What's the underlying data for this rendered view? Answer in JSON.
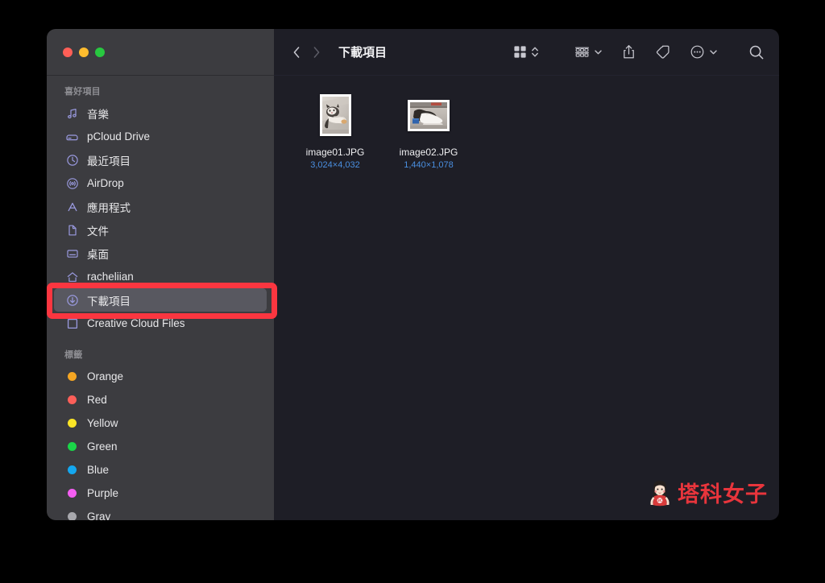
{
  "window": {
    "traffic_lights": {
      "close": "close",
      "minimize": "minimize",
      "maximize": "maximize"
    }
  },
  "toolbar": {
    "back_label": "‹",
    "forward_label": "›",
    "folder_title": "下載項目",
    "icon_view_label": "icon-view",
    "view_switch_label": "view-options",
    "group_label": "group-by",
    "share_label": "share",
    "tag_label": "tags",
    "more_label": "more-actions",
    "search_label": "search"
  },
  "sidebar": {
    "favorites_header": "喜好項目",
    "favorites": [
      {
        "label": "音樂",
        "icon": "music-note-icon",
        "selected": false
      },
      {
        "label": "pCloud Drive",
        "icon": "external-drive-icon",
        "selected": false
      },
      {
        "label": "最近項目",
        "icon": "clock-icon",
        "selected": false
      },
      {
        "label": "AirDrop",
        "icon": "airdrop-icon",
        "selected": false
      },
      {
        "label": "應用程式",
        "icon": "applications-icon",
        "selected": false
      },
      {
        "label": "文件",
        "icon": "document-icon",
        "selected": false
      },
      {
        "label": "桌面",
        "icon": "desktop-icon",
        "selected": false
      },
      {
        "label": "racheliian",
        "icon": "home-icon",
        "selected": false
      },
      {
        "label": "下載項目",
        "icon": "downloads-icon",
        "selected": true
      },
      {
        "label": "Creative Cloud Files",
        "icon": "folder-square-icon",
        "selected": false
      }
    ],
    "tags_header": "標籤",
    "tags": [
      {
        "label": "Orange",
        "color": "#f5a623"
      },
      {
        "label": "Red",
        "color": "#fc5f59"
      },
      {
        "label": "Yellow",
        "color": "#fbe526"
      },
      {
        "label": "Green",
        "color": "#1ad548"
      },
      {
        "label": "Blue",
        "color": "#14a7ef"
      },
      {
        "label": "Purple",
        "color": "#f45ef2"
      },
      {
        "label": "Gray",
        "color": "#a8a8ad"
      }
    ]
  },
  "files": [
    {
      "name": "image01.JPG",
      "dimensions": "3,024×4,032",
      "orientation": "portrait",
      "subject": "cat-photo"
    },
    {
      "name": "image02.JPG",
      "dimensions": "1,440×1,078",
      "orientation": "landscape",
      "subject": "shoe-photo"
    }
  ],
  "annotation": {
    "target": "下載項目",
    "color": "#fb3640"
  },
  "watermark": {
    "text": "塔科女子",
    "color": "#e8353c",
    "badge": "3C"
  }
}
